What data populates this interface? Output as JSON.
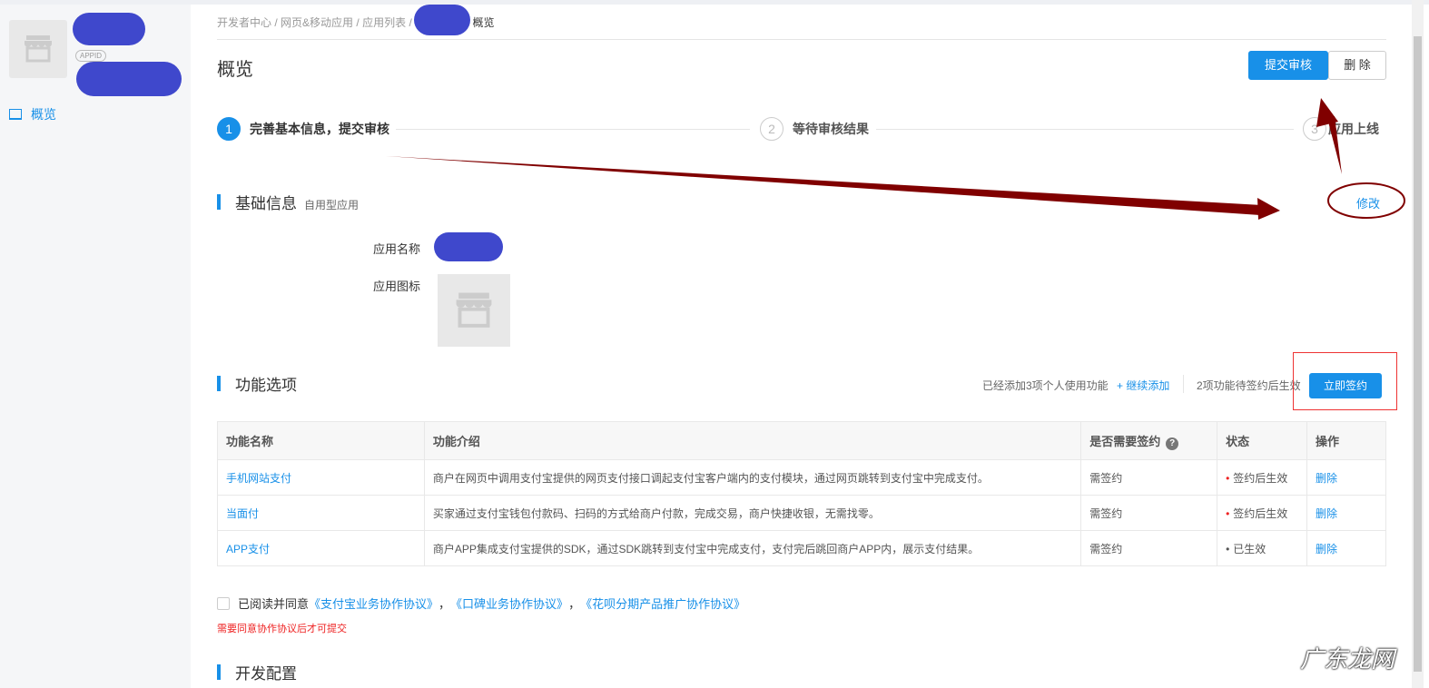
{
  "sidebar": {
    "appid_badge": "APPID",
    "nav": [
      {
        "label": "概览",
        "icon": "dashboard-icon"
      }
    ]
  },
  "breadcrumb": {
    "items": [
      "开发者中心",
      "网页&移动应用",
      "应用列表"
    ],
    "current": "概览",
    "sep": "/"
  },
  "page": {
    "title": "概览",
    "submit_label": "提交审核",
    "delete_label": "删 除"
  },
  "steps": [
    {
      "num": "1",
      "label": "完善基本信息，提交审核"
    },
    {
      "num": "2",
      "label": "等待审核结果"
    },
    {
      "num": "3",
      "label": "应用上线"
    }
  ],
  "basic": {
    "title": "基础信息",
    "subtitle": "自用型应用",
    "edit_label": "修改",
    "name_label": "应用名称",
    "icon_label": "应用图标"
  },
  "features": {
    "title": "功能选项",
    "added_text": "已经添加3项个人使用功能",
    "add_more": "+ 继续添加",
    "pending_text": "2项功能待签约后生效",
    "sign_label": "立即签约",
    "columns": [
      "功能名称",
      "功能介绍",
      "是否需要签约",
      "状态",
      "操作"
    ],
    "rows": [
      {
        "name": "手机网站支付",
        "desc": "商户在网页中调用支付宝提供的网页支付接口调起支付宝客户端内的支付模块，通过网页跳转到支付宝中完成支付。",
        "sign": "需签约",
        "status": "签约后生效",
        "action": "删除"
      },
      {
        "name": "当面付",
        "desc": "买家通过支付宝钱包付款码、扫码的方式给商户付款，完成交易，商户快捷收银，无需找零。",
        "sign": "需签约",
        "status": "签约后生效",
        "action": "删除"
      },
      {
        "name": "APP支付",
        "desc": "商户APP集成支付宝提供的SDK，通过SDK跳转到支付宝中完成支付，支付完后跳回商户APP内，展示支付结果。",
        "sign": "需签约",
        "status": "已生效",
        "action": "删除"
      }
    ]
  },
  "agreement": {
    "prefix": "已阅读并同意",
    "links": [
      "《支付宝业务协作协议》",
      "《口碑业务协作协议》",
      "《花呗分期产品推广协作协议》"
    ],
    "sep": "，",
    "error": "需要同意协作协议后才可提交"
  },
  "dev": {
    "title": "开发配置"
  },
  "watermark": "广东龙网",
  "colors": {
    "primary": "#1890e8",
    "annotation": "#800000",
    "error": "#e22"
  }
}
